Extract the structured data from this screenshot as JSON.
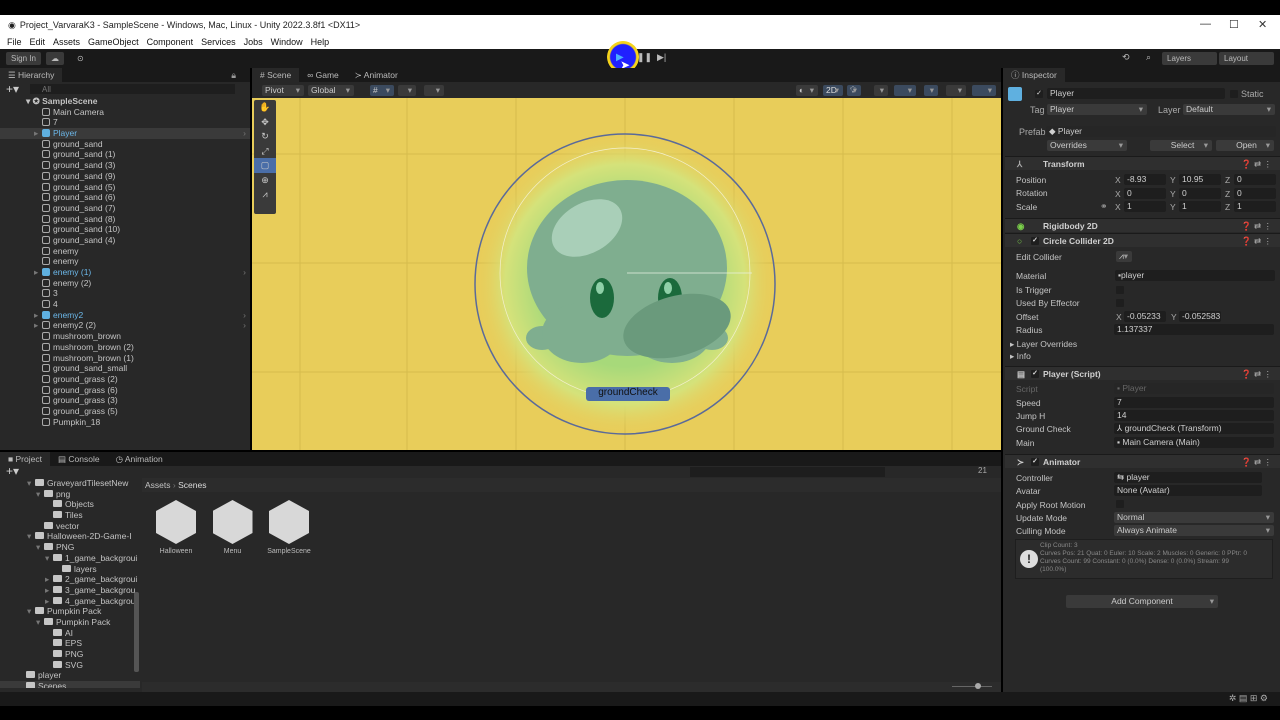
{
  "window": {
    "title": "Project_VarvaraK3 - SampleScene - Windows, Mac, Linux - Unity 2022.3.8f1 <DX11>"
  },
  "menu": [
    "File",
    "Edit",
    "Assets",
    "GameObject",
    "Component",
    "Services",
    "Jobs",
    "Window",
    "Help"
  ],
  "toolbar": {
    "sign_in": "Sign In",
    "layers": "Layers",
    "layout": "Layout"
  },
  "hierarchy": {
    "tab": "Hierarchy",
    "search_placeholder": "All",
    "scene": "SampleScene",
    "items": [
      {
        "label": "Main Camera",
        "blue": false
      },
      {
        "label": "7",
        "blue": false
      },
      {
        "label": "Player",
        "blue": true,
        "selected": true,
        "arrow": true
      },
      {
        "label": "ground_sand"
      },
      {
        "label": "ground_sand (1)"
      },
      {
        "label": "ground_sand (3)"
      },
      {
        "label": "ground_sand (9)"
      },
      {
        "label": "ground_sand (5)"
      },
      {
        "label": "ground_sand (6)"
      },
      {
        "label": "ground_sand (7)"
      },
      {
        "label": "ground_sand (8)"
      },
      {
        "label": "ground_sand (10)"
      },
      {
        "label": "ground_sand (4)"
      },
      {
        "label": "enemy"
      },
      {
        "label": "enemy"
      },
      {
        "label": "enemy (1)",
        "blue": true,
        "arrow": true
      },
      {
        "label": "enemy (2)"
      },
      {
        "label": "3"
      },
      {
        "label": "4"
      },
      {
        "label": "enemy2",
        "blue": true,
        "arrow": true
      },
      {
        "label": "enemy2 (2)",
        "arrow": true
      },
      {
        "label": "mushroom_brown"
      },
      {
        "label": "mushroom_brown (2)"
      },
      {
        "label": "mushroom_brown (1)"
      },
      {
        "label": "ground_sand_small"
      },
      {
        "label": "ground_grass (2)"
      },
      {
        "label": "ground_grass (6)"
      },
      {
        "label": "ground_grass (3)"
      },
      {
        "label": "ground_grass (5)"
      },
      {
        "label": "Pumpkin_18"
      }
    ]
  },
  "scene": {
    "tabs": [
      "Scene",
      "Game",
      "Animator"
    ],
    "pivot": "Pivot",
    "global": "Global",
    "mode_2d": "2D",
    "label": "groundCheck"
  },
  "project": {
    "tabs": [
      "Project",
      "Console",
      "Animation"
    ],
    "breadcrumb": [
      "Assets",
      "Scenes"
    ],
    "hidden_count": "21",
    "tree": [
      {
        "label": "GraveyardTilesetNew",
        "depth": 1,
        "open": true
      },
      {
        "label": "png",
        "depth": 2,
        "open": true
      },
      {
        "label": "Objects",
        "depth": 3
      },
      {
        "label": "Tiles",
        "depth": 3
      },
      {
        "label": "vector",
        "depth": 2
      },
      {
        "label": "Halloween-2D-Game-I",
        "depth": 1,
        "open": true
      },
      {
        "label": "PNG",
        "depth": 2,
        "open": true
      },
      {
        "label": "1_game_backgroui",
        "depth": 3,
        "open": true
      },
      {
        "label": "layers",
        "depth": 4
      },
      {
        "label": "2_game_backgroui",
        "depth": 3,
        "open": false
      },
      {
        "label": "3_game_backgrou",
        "depth": 3,
        "open": false
      },
      {
        "label": "4_game_backgrou",
        "depth": 3,
        "open": false
      },
      {
        "label": "Pumpkin Pack",
        "depth": 1,
        "open": true
      },
      {
        "label": "Pumpkin Pack",
        "depth": 2,
        "open": true
      },
      {
        "label": "AI",
        "depth": 3
      },
      {
        "label": "EPS",
        "depth": 3
      },
      {
        "label": "PNG",
        "depth": 3
      },
      {
        "label": "SVG",
        "depth": 3
      },
      {
        "label": "player",
        "depth": 0
      },
      {
        "label": "Scenes",
        "depth": 0,
        "selected": true
      }
    ],
    "assets": [
      "Halloween",
      "Menu",
      "SampleScene"
    ]
  },
  "inspector": {
    "tab": "Inspector",
    "name": "Player",
    "static": "Static",
    "tag_label": "Tag",
    "tag": "Player",
    "layer_label": "Layer",
    "layer": "Default",
    "prefab_label": "Prefab",
    "prefab": "Player",
    "overrides": "Overrides",
    "select": "Select",
    "open": "Open",
    "transform": {
      "title": "Transform",
      "position_label": "Position",
      "rotation_label": "Rotation",
      "scale_label": "Scale",
      "position": [
        "-8.93",
        "10.95",
        "0"
      ],
      "rotation": [
        "0",
        "0",
        "0"
      ],
      "scale": [
        "1",
        "1",
        "1"
      ]
    },
    "rigidbody": {
      "title": "Rigidbody 2D"
    },
    "collider": {
      "title": "Circle Collider 2D",
      "edit_label": "Edit Collider",
      "material_label": "Material",
      "material": "player",
      "trigger_label": "Is Trigger",
      "effector_label": "Used By Effector",
      "offset_label": "Offset",
      "offset": [
        "-0.05233",
        "-0.052583"
      ],
      "radius_label": "Radius",
      "radius": "1.137337",
      "layer_overrides": "Layer Overrides",
      "info": "Info"
    },
    "script": {
      "title": "Player (Script)",
      "script_label": "Script",
      "script": "Player",
      "speed_label": "Speed",
      "speed": "7",
      "jump_label": "Jump H",
      "jump": "14",
      "ground_label": "Ground Check",
      "ground": "groundCheck (Transform)",
      "main_label": "Main",
      "main": "Main Camera (Main)"
    },
    "animator": {
      "title": "Animator",
      "controller_label": "Controller",
      "controller": "player",
      "avatar_label": "Avatar",
      "avatar": "None (Avatar)",
      "root_label": "Apply Root Motion",
      "update_label": "Update Mode",
      "update": "Normal",
      "culling_label": "Culling Mode",
      "culling": "Always Animate",
      "info": [
        "Clip Count: 3",
        "Curves Pos: 21 Quat: 0 Euler: 10 Scale: 2 Muscles: 0 Generic: 0 PPtr: 0",
        "Curves Count: 99 Constant: 0 (0.0%) Dense: 0 (0.0%) Stream: 99",
        "(100.0%)"
      ]
    },
    "add_component": "Add Component"
  },
  "colors": {
    "scene_bg": "#e8cd5a",
    "accent_blue": "#5fb0e0",
    "panel": "#282828"
  }
}
